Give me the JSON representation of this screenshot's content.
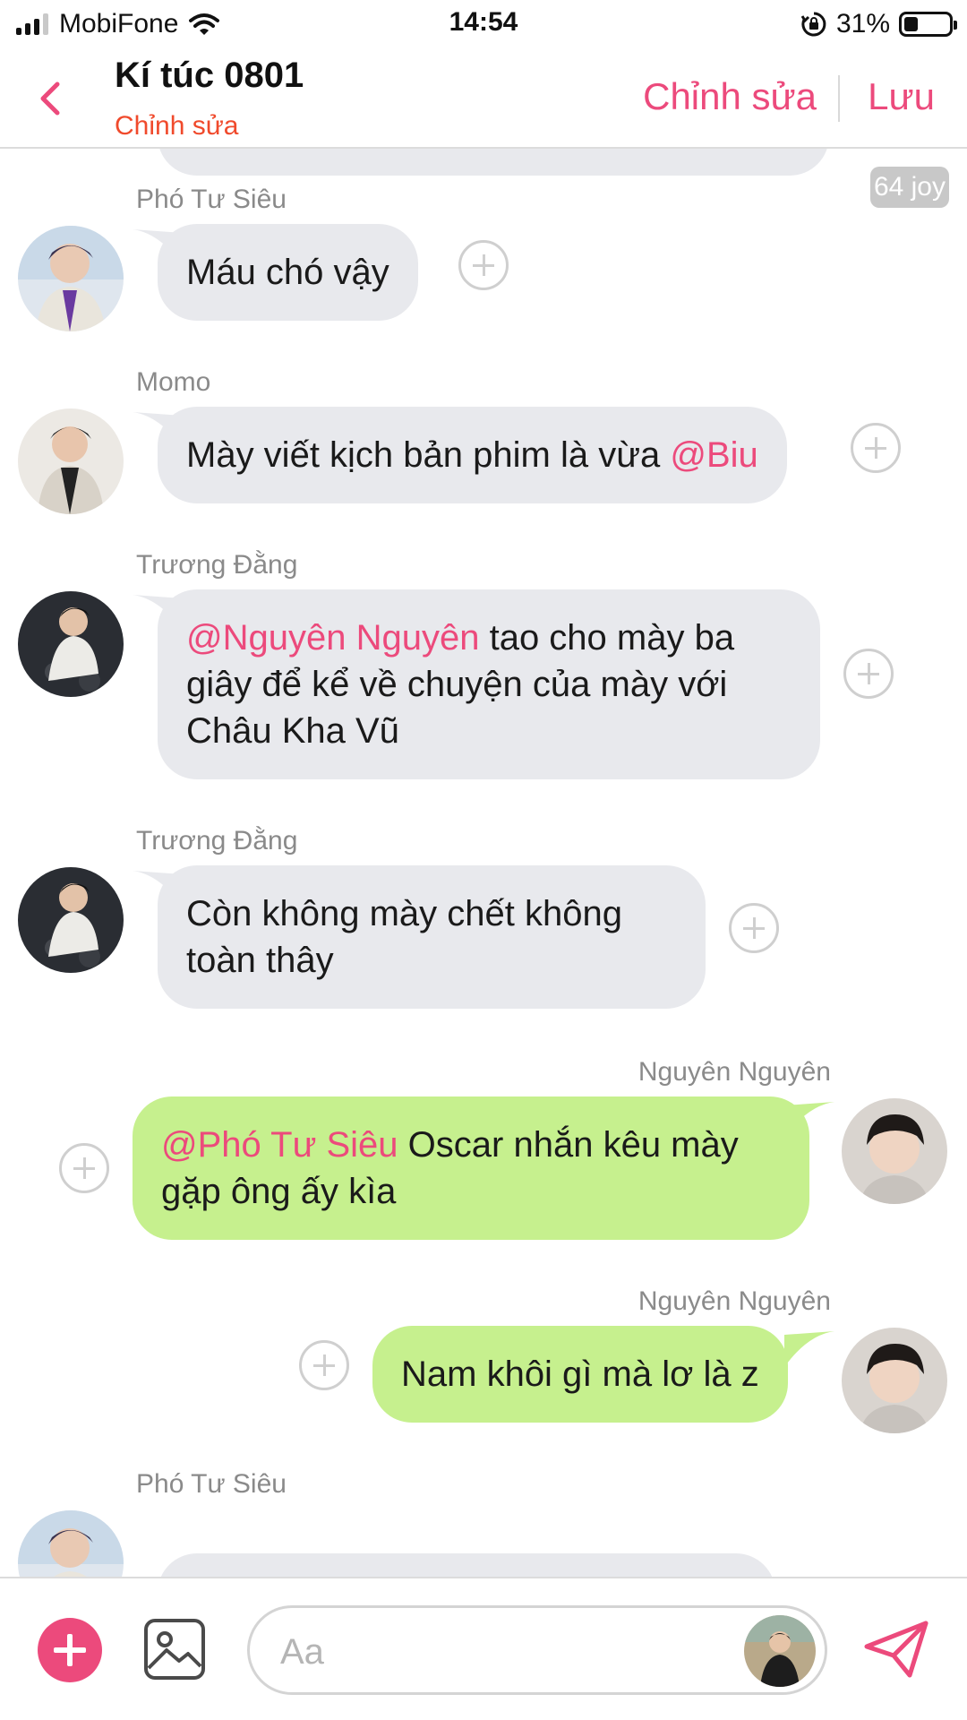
{
  "status_bar": {
    "carrier": "MobiFone",
    "time": "14:54",
    "battery_percent": "31%",
    "battery_level": 0.31,
    "signal_bars_active": 3,
    "signal_bars_total": 4,
    "icons": [
      "signal-icon",
      "wifi-icon",
      "orientation-lock-icon",
      "battery-icon"
    ]
  },
  "header": {
    "title": "Kí túc 0801",
    "subtitle": "Chỉnh sửa",
    "edit_label": "Chỉnh sửa",
    "save_label": "Lưu",
    "back_icon": "chevron-left-icon"
  },
  "chat": {
    "joy_badge": "64 joy",
    "messages": [
      {
        "sender": "Phó Tư Siêu",
        "direction": "incoming",
        "segments": [
          {
            "text": "Máu chó vậy"
          }
        ]
      },
      {
        "sender": "Momo",
        "direction": "incoming",
        "segments": [
          {
            "text": "Mày viết kịch bản phim là vừa "
          },
          {
            "mention": "@Biu"
          }
        ]
      },
      {
        "sender": "Trương Đằng",
        "direction": "incoming",
        "lines": [
          [
            {
              "mention": "@Nguyên Nguyên"
            },
            {
              "text": " tao cho mày ba"
            }
          ],
          [
            {
              "text": "giây để kể về chuyện của mày với"
            }
          ],
          [
            {
              "text": "Châu Kha Vũ"
            }
          ]
        ]
      },
      {
        "sender": "Trương Đằng",
        "direction": "incoming",
        "lines": [
          [
            {
              "text": "Còn không mày chết không"
            }
          ],
          [
            {
              "text": "toàn thây"
            }
          ]
        ]
      },
      {
        "sender": "Nguyên Nguyên",
        "direction": "outgoing",
        "lines": [
          [
            {
              "mention": "@Phó Tư Siêu"
            },
            {
              "text": " Oscar nhắn kêu mày"
            }
          ],
          [
            {
              "text": "gặp ông ấy kìa"
            }
          ]
        ]
      },
      {
        "sender": "Nguyên Nguyên",
        "direction": "outgoing",
        "segments": [
          {
            "text": "Nam khôi gì mà lơ là z"
          }
        ]
      },
      {
        "sender": "Phó Tư Siêu",
        "direction": "incoming",
        "segments": [
          {
            "text": ""
          }
        ]
      }
    ]
  },
  "composer": {
    "placeholder": "Aa",
    "value": "",
    "add_icon": "plus-icon",
    "image_icon": "image-icon",
    "send_icon": "send-icon"
  },
  "colors": {
    "accent": "#ec4a7c",
    "subtitle": "#f04a2c",
    "incoming_bubble": "#e8e9ed",
    "outgoing_bubble": "#c6f08e",
    "sender_name": "#8a8a8a"
  }
}
